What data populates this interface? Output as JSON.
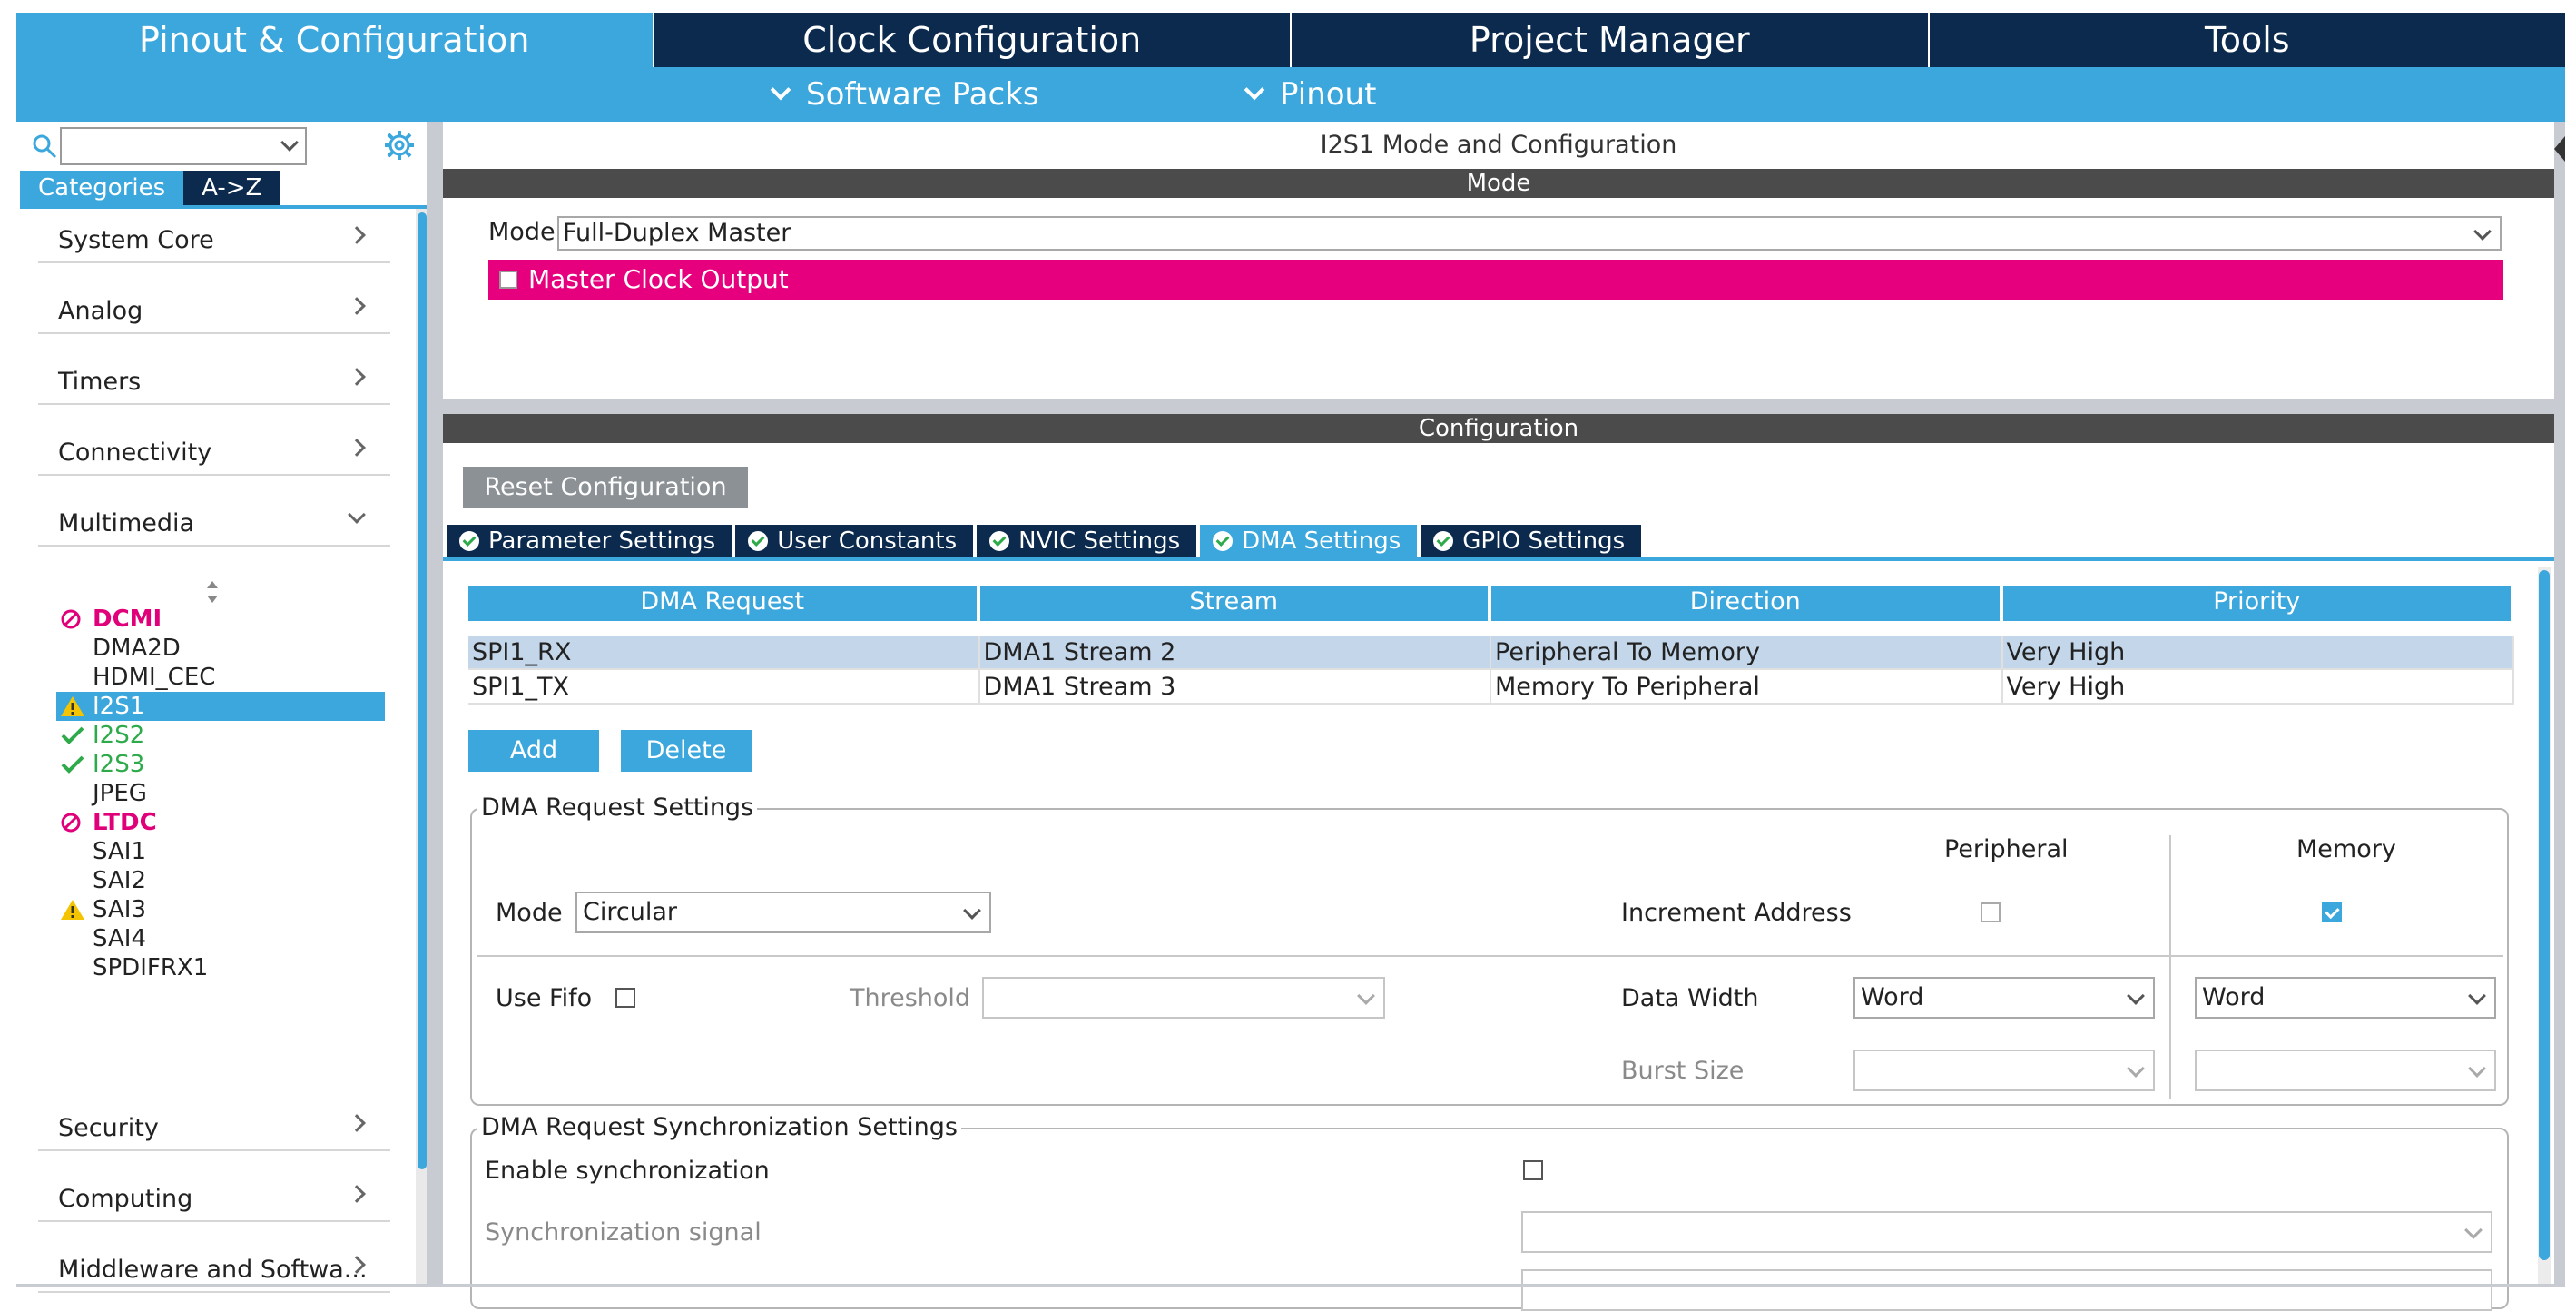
{
  "top_tabs": [
    "Pinout & Configuration",
    "Clock Configuration",
    "Project Manager",
    "Tools"
  ],
  "subbar": {
    "software_packs": "Software Packs",
    "pinout": "Pinout"
  },
  "left": {
    "search_value": "",
    "category_tabs": [
      "Categories",
      "A->Z"
    ],
    "categories": [
      "System Core",
      "Analog",
      "Timers",
      "Connectivity",
      "Multimedia"
    ],
    "multimedia_items": [
      {
        "label": "DCMI",
        "status": "disabled"
      },
      {
        "label": "DMA2D",
        "status": "none"
      },
      {
        "label": "HDMI_CEC",
        "status": "none"
      },
      {
        "label": "I2S1",
        "status": "warning",
        "selected": true
      },
      {
        "label": "I2S2",
        "status": "ok"
      },
      {
        "label": "I2S3",
        "status": "ok"
      },
      {
        "label": "JPEG",
        "status": "none"
      },
      {
        "label": "LTDC",
        "status": "disabled"
      },
      {
        "label": "SAI1",
        "status": "none"
      },
      {
        "label": "SAI2",
        "status": "none"
      },
      {
        "label": "SAI3",
        "status": "warning"
      },
      {
        "label": "SAI4",
        "status": "none"
      },
      {
        "label": "SPDIFRX1",
        "status": "none"
      }
    ],
    "bottom_categories": [
      "Security",
      "Computing",
      "Middleware and Softwa..."
    ]
  },
  "panel": {
    "title": "I2S1 Mode and Configuration",
    "mode_band": "Mode",
    "mode_label": "Mode",
    "mode_value": "Full-Duplex Master",
    "master_clock_output": "Master Clock Output",
    "configuration_band": "Configuration",
    "reset_button": "Reset Configuration",
    "config_tabs": [
      "Parameter Settings",
      "User Constants",
      "NVIC Settings",
      "DMA Settings",
      "GPIO Settings"
    ]
  },
  "dma_table": {
    "headers": [
      "DMA Request",
      "Stream",
      "Direction",
      "Priority"
    ],
    "rows": [
      [
        "SPI1_RX",
        "DMA1 Stream 2",
        "Peripheral To Memory",
        "Very High"
      ],
      [
        "SPI1_TX",
        "DMA1 Stream 3",
        "Memory To Peripheral",
        "Very High"
      ]
    ],
    "add": "Add",
    "delete": "Delete"
  },
  "request_settings": {
    "title": "DMA Request Settings",
    "peripheral": "Peripheral",
    "memory": "Memory",
    "mode_label": "Mode",
    "mode_value": "Circular",
    "increment_address": "Increment Address",
    "use_fifo": "Use Fifo",
    "threshold": "Threshold",
    "data_width": "Data Width",
    "peripheral_width": "Word",
    "memory_width": "Word",
    "burst_size": "Burst Size"
  },
  "sync_settings": {
    "title": "DMA Request Synchronization Settings",
    "enable_sync": "Enable synchronization",
    "sync_signal": "Synchronization signal"
  }
}
